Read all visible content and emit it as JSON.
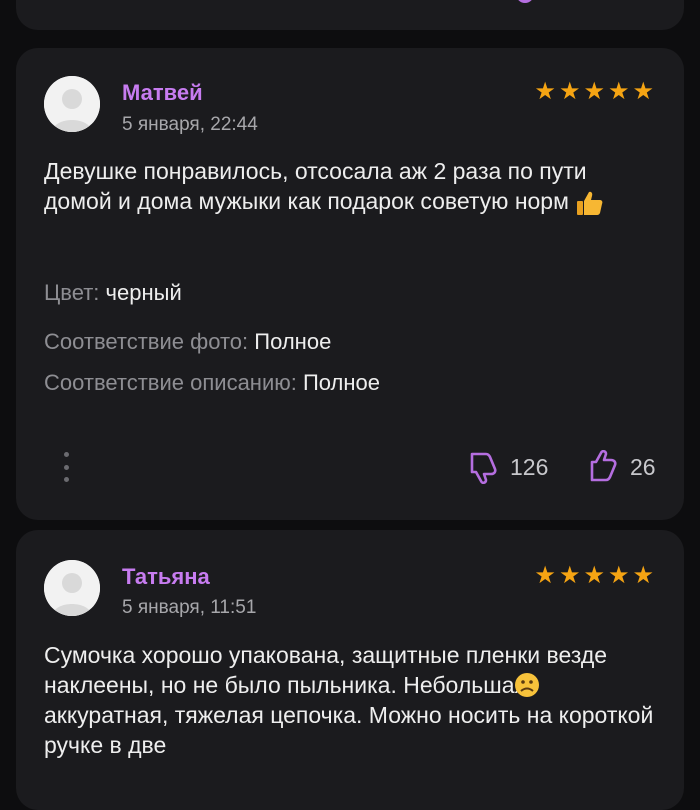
{
  "reviews": [
    {
      "author": "Матвей",
      "date": "5 января, 22:44",
      "rating": 5,
      "text": "Девушке понравилось, отсосала аж 2 раза по пути домой и дома мужыки как подарок советую норм",
      "attributes": [
        {
          "label": "Цвет:",
          "value": "черный"
        },
        {
          "label": "Соответствие фото:",
          "value": "Полное"
        },
        {
          "label": "Соответствие описанию:",
          "value": "Полное"
        }
      ],
      "dislikes": "126",
      "likes": "26"
    },
    {
      "author": "Татьяна",
      "date": "5 января, 11:51",
      "rating": 5,
      "text": "Сумочка хорошо упакована, защитные пленки везде наклеены, но не было пыльника. Небольшая, аккуратная, тяжелая цепочка. Можно носить на короткой ручке в две"
    }
  ],
  "icons": {
    "star": "star-icon",
    "dislike": "thumb-down-icon",
    "like": "thumb-up-icon",
    "more": "more-vertical-icon"
  },
  "colors": {
    "background": "#0d0d0f",
    "card": "#1b1b1e",
    "author": "#c77cf0",
    "star": "#f5a413",
    "vote_icon": "#b56ee0"
  }
}
